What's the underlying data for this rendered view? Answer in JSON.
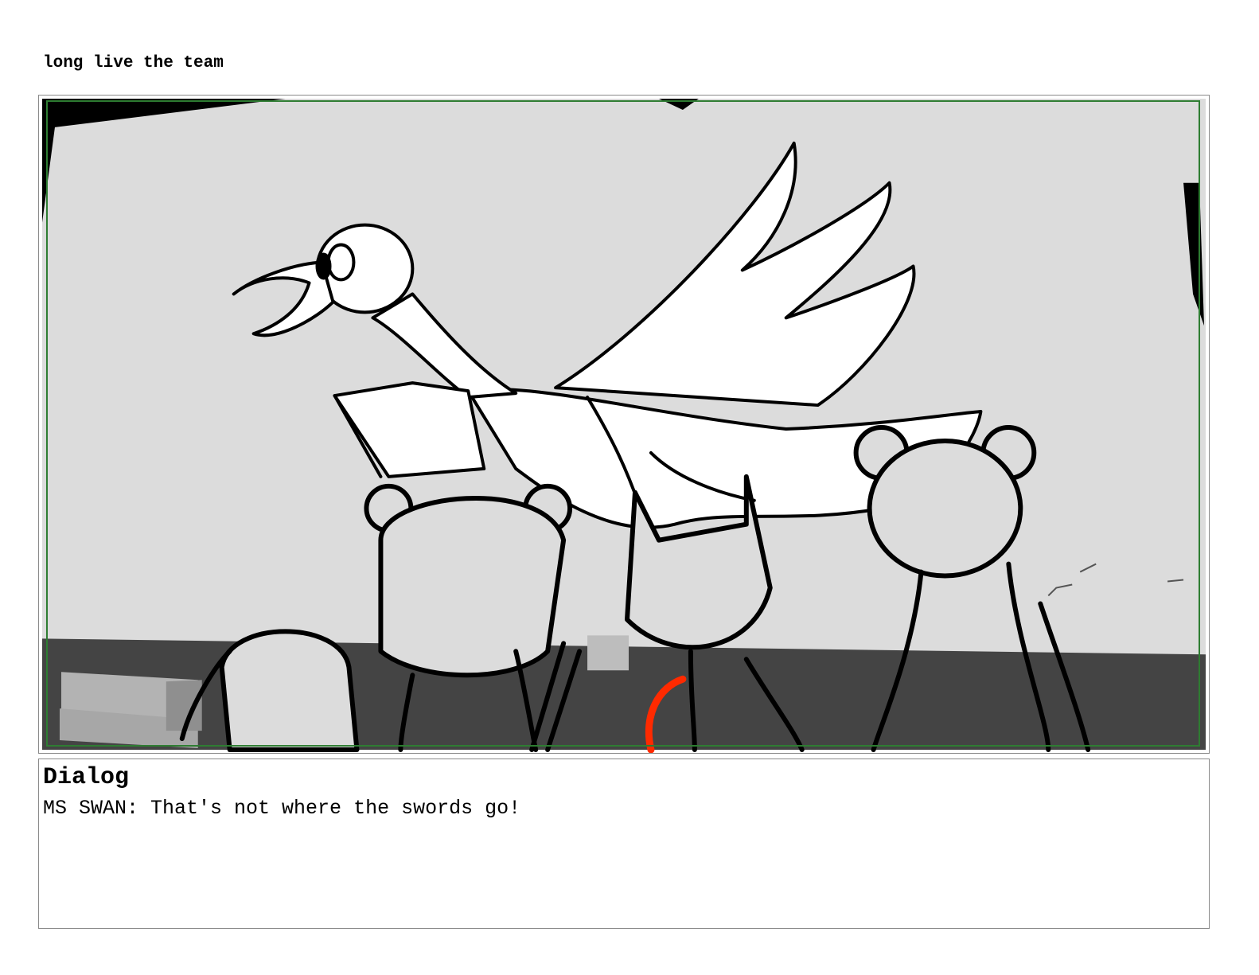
{
  "scene": {
    "title": "long live the team"
  },
  "panel": {
    "image_description_icon": "storyboard-sketch-image",
    "colors": {
      "sky": "#dcdcdc",
      "floor": "#444444",
      "frame_green": "#2e7d32",
      "accent_red": "#ff2a00"
    }
  },
  "dialog": {
    "heading": "Dialog",
    "text": "MS SWAN: That's not where the swords go!"
  }
}
